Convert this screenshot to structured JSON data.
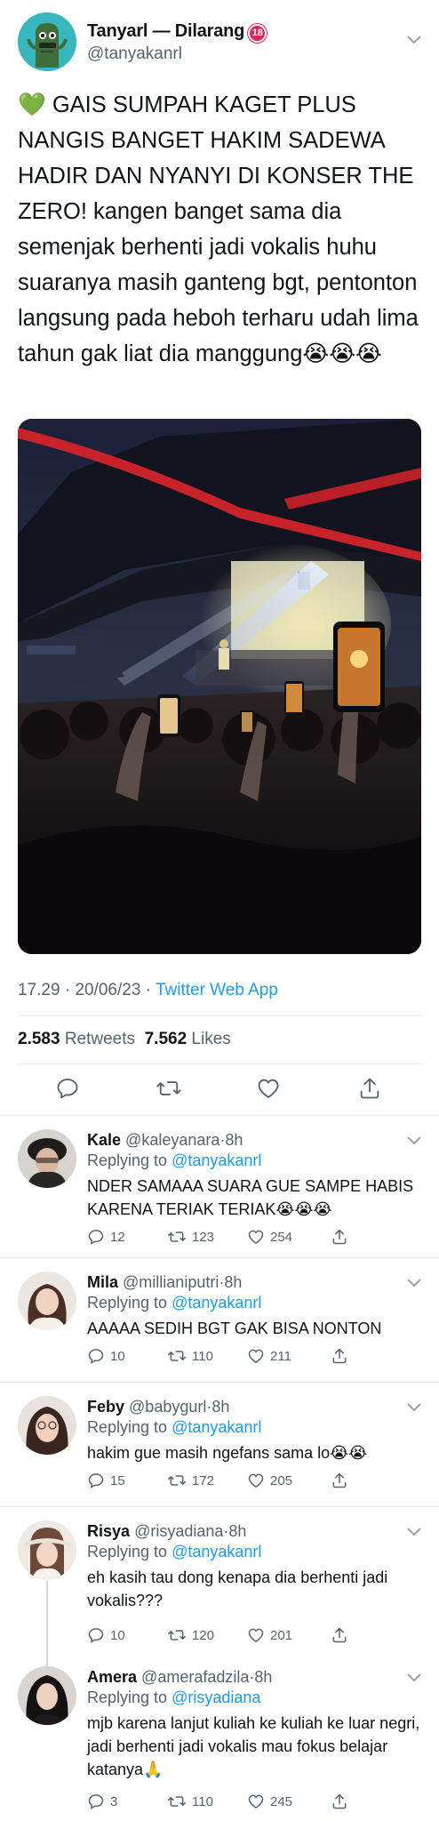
{
  "tweet": {
    "display_name": "Tanyarl — Dilarang",
    "badge": "18",
    "handle": "@tanyakanrl",
    "text": "💚 GAIS SUMPAH KAGET PLUS NANGIS BANGET HAKIM SADEWA HADIR DAN NYANYI DI KONSER THE ZERO! kangen banget sama dia semenjak berhenti jadi vokalis huhu suaranya masih ganteng bgt, pentonton langsung pada heboh terharu udah lima tahun gak liat dia manggung😭😭😭",
    "time": "17.29",
    "date": "20/06/23",
    "dot": "·",
    "app": "Twitter Web App",
    "retweets": "2.583",
    "retweets_label": "Retweets",
    "likes": "7.562",
    "likes_label": "Likes",
    "icons": [
      "reply-icon",
      "retweet-icon",
      "like-icon",
      "share-icon",
      "chevron-down-icon"
    ]
  },
  "replies": [
    {
      "name": "Kale",
      "handle": "@kaleyanara",
      "time": "8h",
      "replying_label": "Replying to",
      "replying_to": "@tanyakanrl",
      "text": "NDER SAMAAA SUARA GUE SAMPE HABIS KARENA TERIAK TERIAK😭😭😭",
      "replies": "12",
      "retweets": "123",
      "likes": "254"
    },
    {
      "name": "Mila",
      "handle": "@millianiputri",
      "time": "8h",
      "replying_label": "Replying to",
      "replying_to": "@tanyakanrl",
      "text": "AAAAA SEDIH BGT GAK BISA NONTON",
      "replies": "10",
      "retweets": "110",
      "likes": "211"
    },
    {
      "name": "Feby",
      "handle": "@babygurl",
      "time": "8h",
      "replying_label": "Replying to",
      "replying_to": "@tanyakanrl",
      "text": "hakim gue masih ngefans sama lo😭😭",
      "replies": "15",
      "retweets": "172",
      "likes": "205"
    },
    {
      "name": "Risya",
      "handle": "@risyadiana",
      "time": "8h",
      "replying_label": "Replying to",
      "replying_to": "@tanyakanrl",
      "text": "eh kasih tau dong kenapa dia berhenti jadi vokalis???",
      "replies": "10",
      "retweets": "120",
      "likes": "201"
    },
    {
      "name": "Amera",
      "handle": "@amerafadzila",
      "time": "8h",
      "replying_label": "Replying to",
      "replying_to": "@risyadiana",
      "text": "mjb karena lanjut kuliah ke kuliah ke luar negri, jadi berhenti jadi vokalis mau fokus belajar katanya🙏",
      "replies": "3",
      "retweets": "110",
      "likes": "245"
    }
  ],
  "colors": {
    "link": "#1d9bf0",
    "secondary": "#536471",
    "divider": "#e6ecf0",
    "badge": "#e0245e",
    "avatar_main": "#3ab6bd"
  }
}
